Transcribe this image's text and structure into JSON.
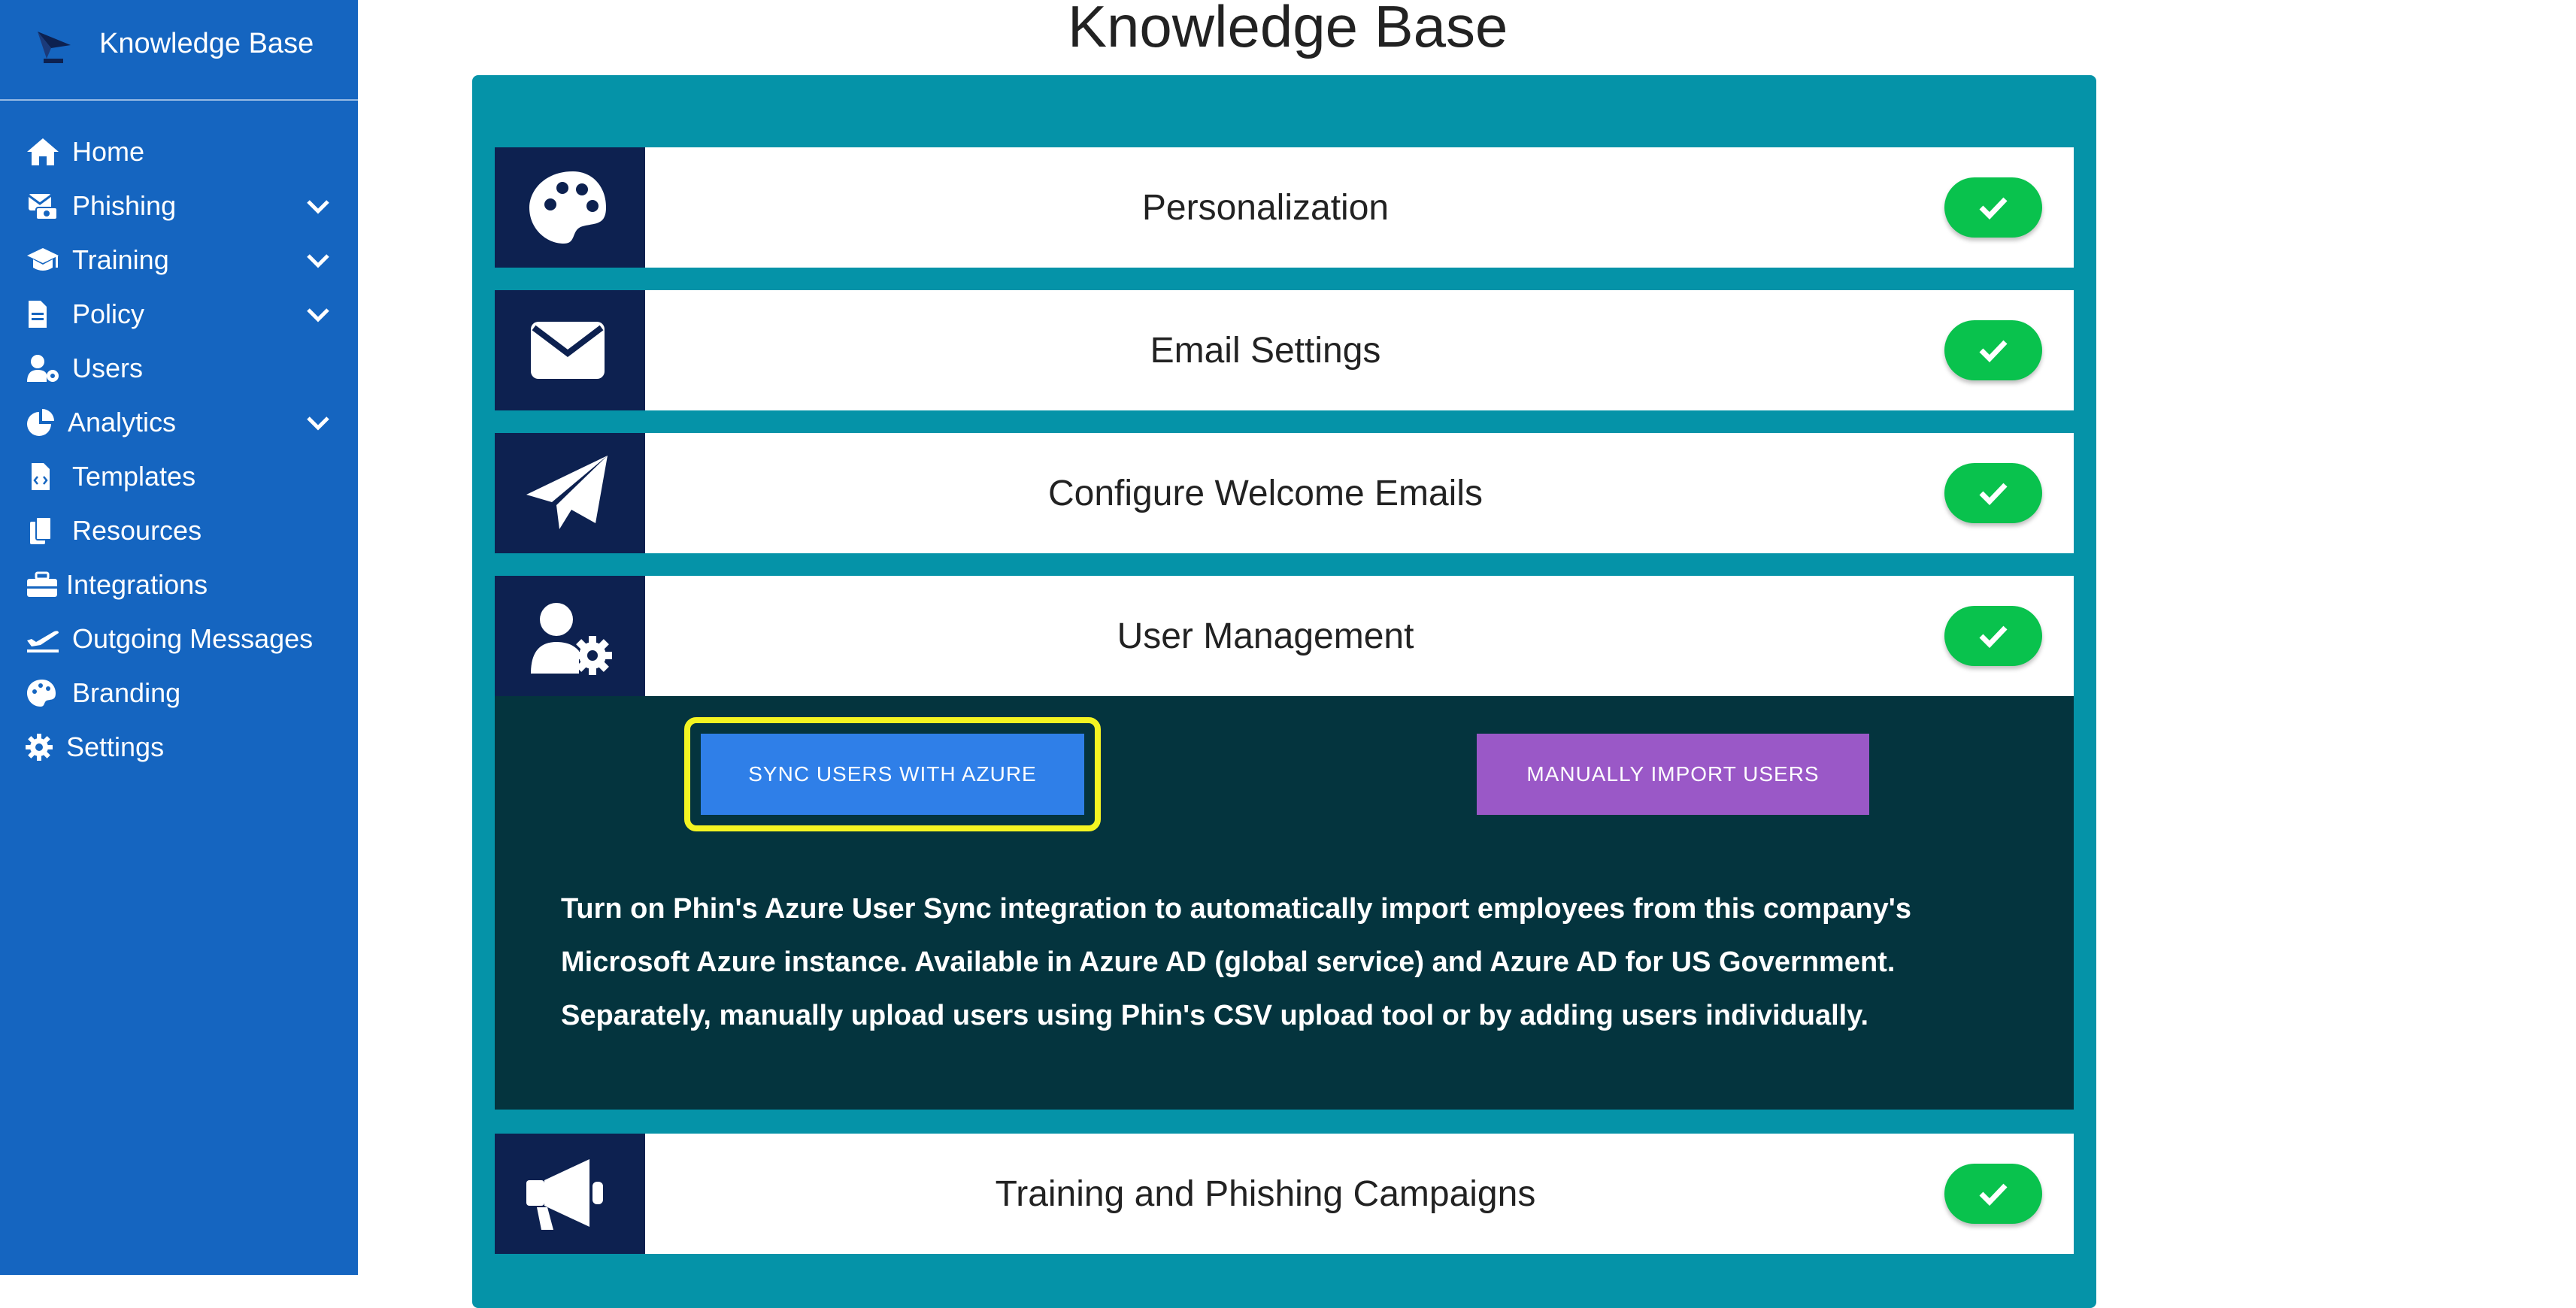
{
  "sidebar": {
    "brand_title": "Knowledge Base",
    "logo_icon": "phin-logo",
    "items": [
      {
        "label": "Home",
        "icon": "home-icon",
        "expandable": false
      },
      {
        "label": "Phishing",
        "icon": "phishing-icon",
        "expandable": true
      },
      {
        "label": "Training",
        "icon": "graduation-cap-icon",
        "expandable": true
      },
      {
        "label": "Policy",
        "icon": "document-icon",
        "expandable": true
      },
      {
        "label": "Users",
        "icon": "user-gear-icon",
        "expandable": false
      },
      {
        "label": "Analytics",
        "icon": "pie-chart-icon",
        "expandable": true
      },
      {
        "label": "Templates",
        "icon": "code-file-icon",
        "expandable": false
      },
      {
        "label": "Resources",
        "icon": "copy-icon",
        "expandable": false
      },
      {
        "label": "Integrations",
        "icon": "toolbox-icon",
        "expandable": false
      },
      {
        "label": "Outgoing Messages",
        "icon": "plane-departure-icon",
        "expandable": false
      },
      {
        "label": "Branding",
        "icon": "palette-icon",
        "expandable": false
      },
      {
        "label": "Settings",
        "icon": "gear-icon",
        "expandable": false
      }
    ]
  },
  "main": {
    "title": "Knowledge Base",
    "sections": [
      {
        "title": "Personalization",
        "icon": "palette-icon",
        "completed": true
      },
      {
        "title": "Email Settings",
        "icon": "envelope-icon",
        "completed": true
      },
      {
        "title": "Configure Welcome Emails",
        "icon": "paper-plane-icon",
        "completed": true
      },
      {
        "title": "User Management",
        "icon": "user-gear-icon",
        "completed": true
      },
      {
        "title": "Training and Phishing Campaigns",
        "icon": "megaphone-icon",
        "completed": true
      }
    ],
    "user_management": {
      "sync_button": "SYNC USERS WITH AZURE",
      "manual_button": "MANUALLY IMPORT USERS",
      "description": "Turn on Phin's Azure User Sync integration to automatically import employees from this company's Microsoft Azure instance. Available in Azure AD (global service) and Azure AD for US Government. Separately, manually upload users using Phin's CSV upload tool or by adding users individually."
    }
  },
  "colors": {
    "sidebar": "#1565c0",
    "panel": "#0593a8",
    "icon_box": "#0d2150",
    "expanded_bg": "#04343e",
    "check": "#09c24d",
    "sync_button": "#2f7fe8",
    "manual_button": "#9a58c7",
    "highlight": "#f4f422"
  }
}
